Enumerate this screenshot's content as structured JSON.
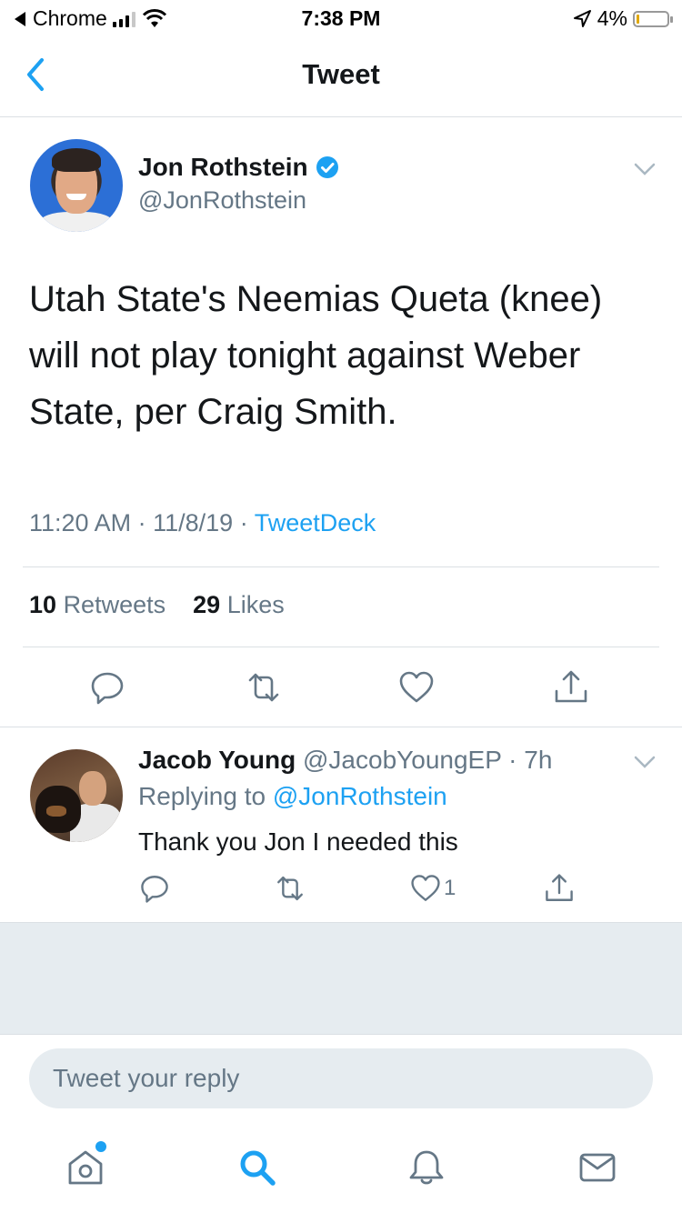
{
  "status_bar": {
    "back_app": "Chrome",
    "time": "7:38 PM",
    "battery": "4%"
  },
  "nav": {
    "title": "Tweet"
  },
  "tweet": {
    "author_name": "Jon Rothstein",
    "author_handle": "@JonRothstein",
    "text": "Utah State's Neemias Queta (knee) will not play tonight against Weber State, per Craig Smith.",
    "time": "11:20 AM",
    "date": "11/8/19",
    "source": "TweetDeck",
    "retweets": "10",
    "retweets_label": "Retweets",
    "likes": "29",
    "likes_label": "Likes"
  },
  "reply": {
    "name": "Jacob Young",
    "handle": "@JacobYoungEP",
    "age": "7h",
    "replying_label": "Replying to",
    "replying_handle": "@JonRothstein",
    "text": "Thank you Jon I needed this",
    "like_count": "1"
  },
  "compose": {
    "placeholder": "Tweet your reply"
  },
  "icons": {
    "accent": "#1da1f2",
    "muted": "#657786",
    "verified": "#1da1f2"
  }
}
